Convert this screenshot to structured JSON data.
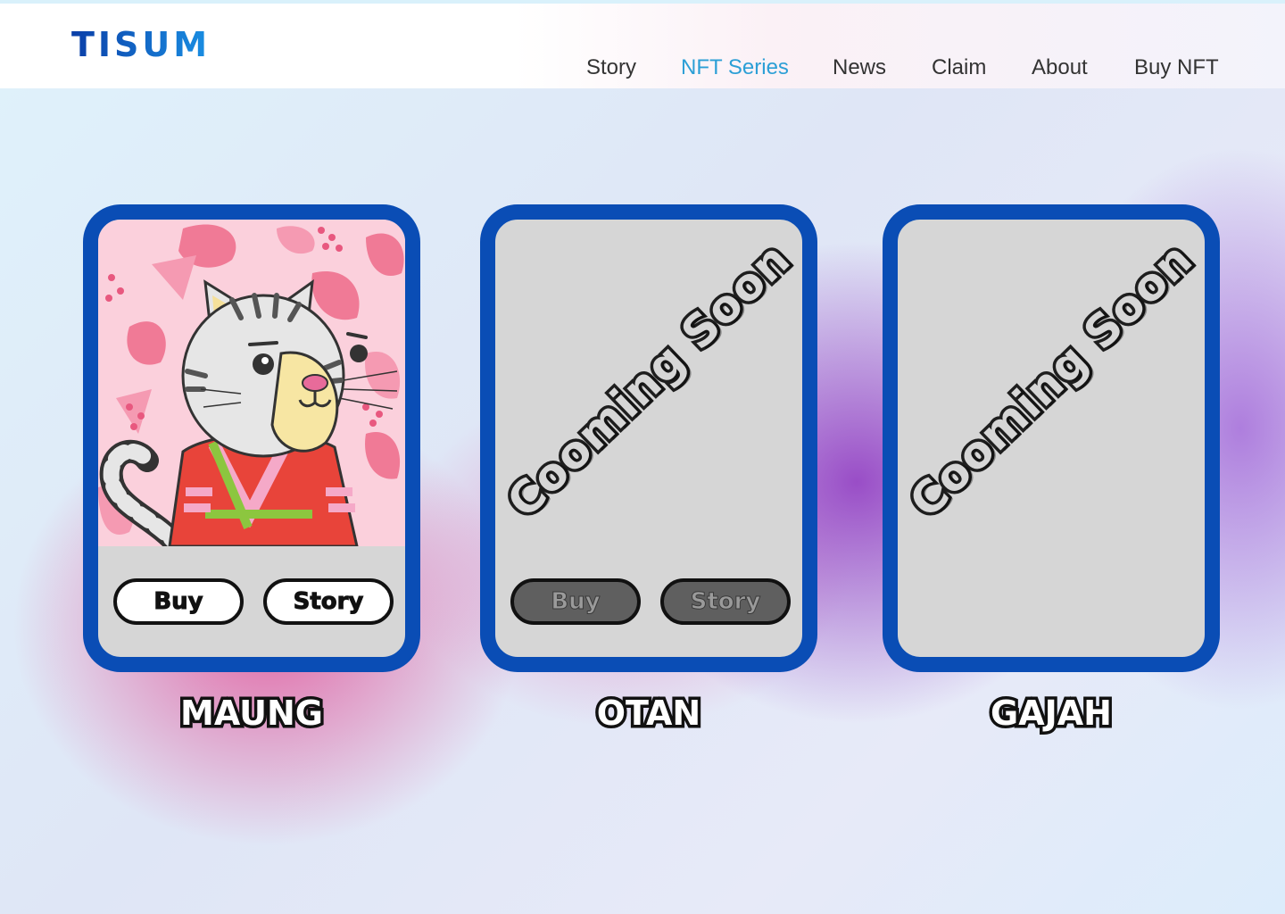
{
  "header": {
    "logo": "TISUM",
    "nav": [
      {
        "label": "Story",
        "active": false
      },
      {
        "label": "NFT Series",
        "active": true
      },
      {
        "label": "News",
        "active": false
      },
      {
        "label": "Claim",
        "active": false
      },
      {
        "label": "About",
        "active": false
      },
      {
        "label": "Buy NFT",
        "active": false
      }
    ]
  },
  "colors": {
    "brand_blue": "#0a4db5",
    "nav_active": "#2c9fd6",
    "card_fill": "#d6d6d6"
  },
  "cards": [
    {
      "name": "MAUNG",
      "image": "tiger-cat-nft-artwork",
      "buy_label": "Buy",
      "story_label": "Story",
      "buttons_enabled": true
    },
    {
      "name": "OTAN",
      "overlay": "Cooming Soon",
      "buy_label": "Buy",
      "story_label": "Story",
      "buttons_enabled": false
    },
    {
      "name": "GAJAH",
      "overlay": "Cooming Soon"
    }
  ]
}
